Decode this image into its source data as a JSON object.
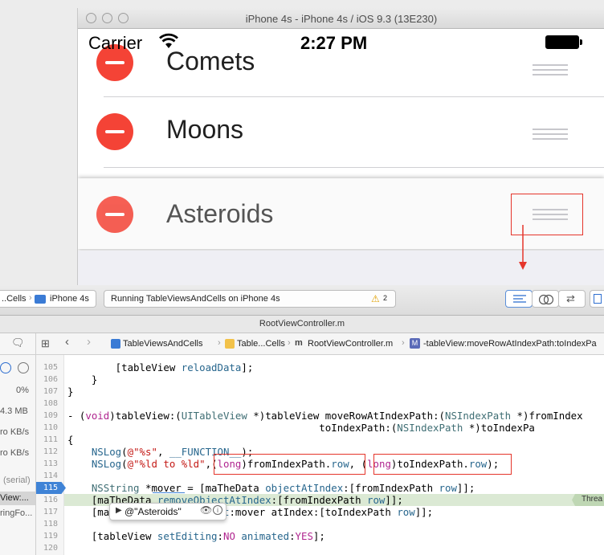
{
  "simulator": {
    "window_title": "iPhone 4s - iPhone 4s / iOS 9.3 (13E230)",
    "carrier": "Carrier",
    "time": "2:27 PM",
    "rows": [
      {
        "label": "Comets"
      },
      {
        "label": "Moons"
      },
      {
        "label": "Asteroids"
      }
    ]
  },
  "toolbar": {
    "scheme": "..Cells",
    "device": "iPhone 4s",
    "status": "Running TableViewsAndCells on iPhone 4s",
    "warning_count": "2"
  },
  "editor": {
    "file_title": "RootViewController.m",
    "breadcrumbs": [
      "TableViewsAndCells",
      "Table...Cells",
      "RootViewController.m",
      "-tableView:moveRowAtIndexPath:toIndexPa"
    ],
    "thread_badge": "Threa",
    "popover_value": "@\"Asteroids\"",
    "variable_name": "mover"
  },
  "debug_gauges": {
    "cpu": "0%",
    "memory": "4.3 MB",
    "disk": "ro KB/s",
    "network": "ro KB/s",
    "thread_queue": "(serial)",
    "thread_frame": "View:...",
    "thread_frame2": "ringFo..."
  },
  "code": {
    "lines": [
      {
        "n": "105",
        "text": "        [tableView reloadData];"
      },
      {
        "n": "106",
        "text": "    }"
      },
      {
        "n": "107",
        "text": "}"
      },
      {
        "n": "108",
        "text": ""
      },
      {
        "n": "109",
        "text": "- (void)tableView:(UITableView *)tableView moveRowAtIndexPath:(NSIndexPath *)fromIndex"
      },
      {
        "n": "110",
        "text": "                                          toIndexPath:(NSIndexPath *)toIndexPa"
      },
      {
        "n": "111",
        "text": "{"
      },
      {
        "n": "112",
        "text": "    NSLog(@\"%s\", __FUNCTION__);"
      },
      {
        "n": "113",
        "text": "    NSLog(@\"%ld to %ld\",(long)fromIndexPath.row, (long)toIndexPath.row);"
      },
      {
        "n": "114",
        "text": ""
      },
      {
        "n": "115",
        "text": "    NSString *mover = [maTheData objectAtIndex:[fromIndexPath row]];"
      },
      {
        "n": "116",
        "text": "    [maTheData removeObjectAtIndex:[fromIndexPath row]];"
      },
      {
        "n": "117",
        "text": "    [maTheData insertObject:mover atIndex:[toIndexPath row]];"
      },
      {
        "n": "118",
        "text": ""
      },
      {
        "n": "119",
        "text": "    [tableView setEditing:NO animated:YES];"
      },
      {
        "n": "120",
        "text": ""
      }
    ]
  }
}
